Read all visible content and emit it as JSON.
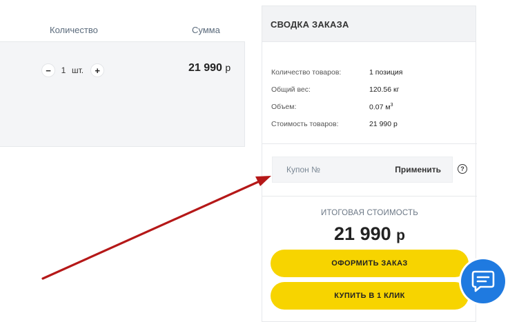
{
  "cart": {
    "columns": {
      "quantity": "Количество",
      "sum": "Сумма"
    },
    "item": {
      "minus": "−",
      "quantity": "1",
      "unit": "шт.",
      "plus": "+",
      "price": "21 990",
      "currency": "р"
    }
  },
  "summary": {
    "title": "СВОДКА ЗАКАЗА",
    "rows": [
      {
        "label": "Количество товаров:",
        "value": "1 позиция"
      },
      {
        "label": "Общий вес:",
        "value": "120.56 кг"
      },
      {
        "label": "Объем:",
        "value": "0.07 м",
        "sup": "3"
      },
      {
        "label": "Стоимость товаров:",
        "value": "21 990 р"
      }
    ],
    "coupon": {
      "placeholder": "Купон №",
      "value": "",
      "apply": "Применить",
      "help": "?"
    },
    "total_label": "ИТОГОВАЯ СТОИМОСТЬ",
    "total_value": "21 990",
    "total_currency": "р",
    "order_button": "ОФОРМИТЬ ЗАКАЗ",
    "oneclick_button": "КУПИТЬ В 1 КЛИК"
  },
  "colors": {
    "accent": "#f7d400",
    "chat": "#1f7ae0",
    "arrow": "#b51818"
  },
  "icons": {
    "chat": "chat-bubble-icon",
    "help": "question-circle-icon",
    "annotation": "red-arrow"
  }
}
